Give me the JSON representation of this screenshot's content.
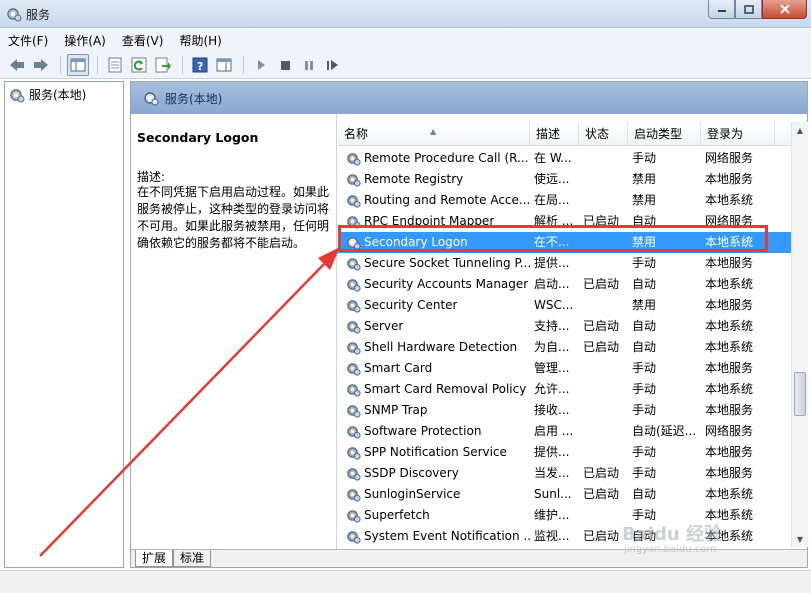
{
  "window": {
    "title": "服务"
  },
  "menu": [
    "文件(F)",
    "操作(A)",
    "查看(V)",
    "帮助(H)"
  ],
  "tree": {
    "root_label": "服务(本地)"
  },
  "panel": {
    "header": "服务(本地)",
    "selected_title": "Secondary Logon",
    "desc_label": "描述:",
    "desc_text": "在不同凭据下启用启动过程。如果此服务被停止，这种类型的登录访问将不可用。如果此服务被禁用，任何明确依赖它的服务都将不能启动。"
  },
  "columns": {
    "name": "名称",
    "desc": "描述",
    "status": "状态",
    "startup": "启动类型",
    "logon": "登录为"
  },
  "services": [
    {
      "name": "Remote Procedure Call (R...",
      "desc": "在 W...",
      "status": "",
      "startup": "手动",
      "logon": "网络服务"
    },
    {
      "name": "Remote Registry",
      "desc": "使远...",
      "status": "",
      "startup": "禁用",
      "logon": "本地服务"
    },
    {
      "name": "Routing and Remote Acce...",
      "desc": "在局...",
      "status": "",
      "startup": "禁用",
      "logon": "本地系统"
    },
    {
      "name": "RPC Endpoint Mapper",
      "desc": "解析 ...",
      "status": "已启动",
      "startup": "自动",
      "logon": "网络服务"
    },
    {
      "name": "Secondary Logon",
      "desc": "在不...",
      "status": "",
      "startup": "禁用",
      "logon": "本地系统",
      "selected": true
    },
    {
      "name": "Secure Socket Tunneling P...",
      "desc": "提供...",
      "status": "",
      "startup": "手动",
      "logon": "本地服务"
    },
    {
      "name": "Security Accounts Manager",
      "desc": "启动...",
      "status": "已启动",
      "startup": "自动",
      "logon": "本地系统"
    },
    {
      "name": "Security Center",
      "desc": "WSC...",
      "status": "",
      "startup": "禁用",
      "logon": "本地服务"
    },
    {
      "name": "Server",
      "desc": "支持...",
      "status": "已启动",
      "startup": "自动",
      "logon": "本地系统"
    },
    {
      "name": "Shell Hardware Detection",
      "desc": "为自...",
      "status": "已启动",
      "startup": "自动",
      "logon": "本地系统"
    },
    {
      "name": "Smart Card",
      "desc": "管理...",
      "status": "",
      "startup": "手动",
      "logon": "本地服务"
    },
    {
      "name": "Smart Card Removal Policy",
      "desc": "允许...",
      "status": "",
      "startup": "手动",
      "logon": "本地系统"
    },
    {
      "name": "SNMP Trap",
      "desc": "接收...",
      "status": "",
      "startup": "手动",
      "logon": "本地服务"
    },
    {
      "name": "Software Protection",
      "desc": "启用 ...",
      "status": "",
      "startup": "自动(延迟...",
      "logon": "网络服务"
    },
    {
      "name": "SPP Notification Service",
      "desc": "提供...",
      "status": "",
      "startup": "手动",
      "logon": "本地服务"
    },
    {
      "name": "SSDP Discovery",
      "desc": "当发...",
      "status": "已启动",
      "startup": "手动",
      "logon": "本地服务"
    },
    {
      "name": "SunloginService",
      "desc": "Sunl...",
      "status": "已启动",
      "startup": "自动",
      "logon": "本地系统"
    },
    {
      "name": "Superfetch",
      "desc": "维护...",
      "status": "",
      "startup": "手动",
      "logon": "本地系统"
    },
    {
      "name": "System Event Notification ...",
      "desc": "监视...",
      "status": "已启动",
      "startup": "自动",
      "logon": "本地系统"
    }
  ],
  "tabs": [
    "扩展",
    "标准"
  ],
  "watermark": {
    "brand": "Baidu 经验",
    "url": "jingyan.baidu.com"
  },
  "colors": {
    "selection": "#3399ff",
    "annotation": "#e43b34"
  }
}
